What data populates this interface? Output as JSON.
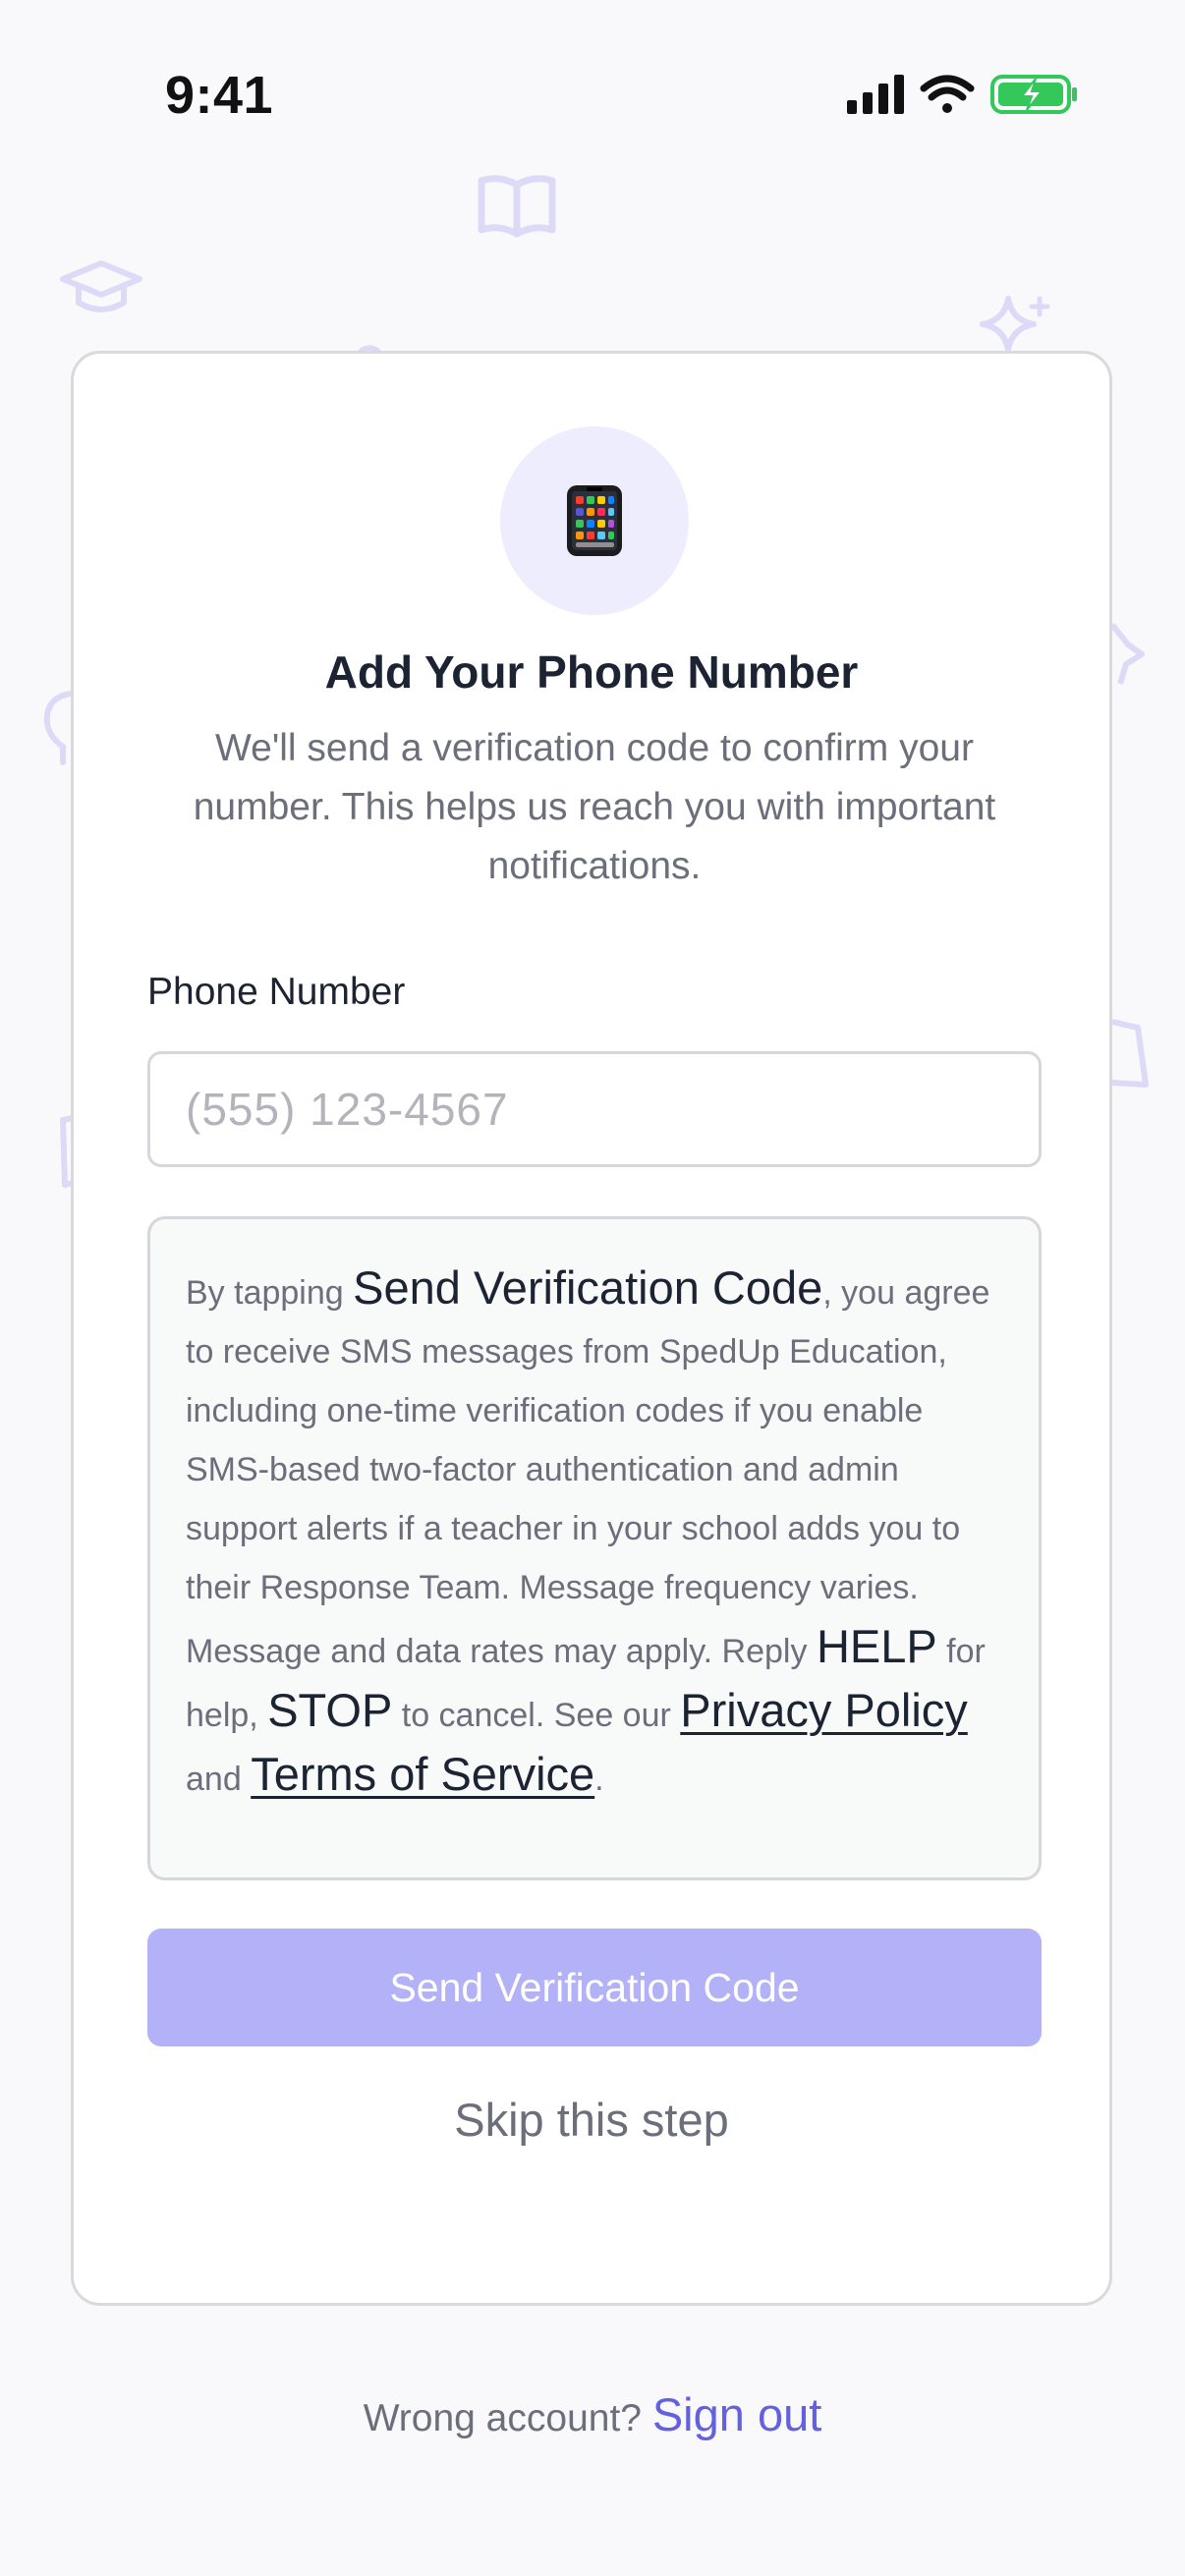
{
  "status_bar": {
    "time": "9:41",
    "icons": [
      "cellular-signal-icon",
      "wifi-icon",
      "battery-charging-icon"
    ]
  },
  "background_icons": [
    "book-icon",
    "graduation-cap-icon",
    "sparkle-icon",
    "star-icon",
    "lightbulb-icon",
    "document-icon"
  ],
  "card": {
    "icon": "mobile-phone-icon",
    "title": "Add Your Phone Number",
    "subtitle": "We'll send a verification code to confirm your number. This helps us reach you with important notifications.",
    "phone_label": "Phone Number",
    "phone_value": "",
    "phone_placeholder": "(555) 123-4567",
    "consent": {
      "part1": "By tapping ",
      "send_code": "Send Verification Code",
      "part2": ", you agree to receive SMS messages from SpedUp Education, including one-time verification codes if you enable SMS-based two-factor authentication and admin support alerts if a teacher in your school adds you to their Response Team. Message frequency varies. Message and data rates may apply. Reply ",
      "help": "HELP",
      "part3": " for help, ",
      "stop": "STOP",
      "part4": " to cancel. See our ",
      "privacy_policy": "Privacy Policy",
      "part5": " and ",
      "terms": "Terms of Service",
      "part6": "."
    },
    "send_button": "Send Verification Code",
    "skip": "Skip this step"
  },
  "footer": {
    "wrong_account": "Wrong account?",
    "sign_out": "Sign out"
  },
  "colors": {
    "accent": "#6461e0",
    "button_disabled": "#b3b1f7",
    "icon_circle": "#eeedfd",
    "deco_icon": "#dcdaf6",
    "battery_green": "#34c759"
  }
}
